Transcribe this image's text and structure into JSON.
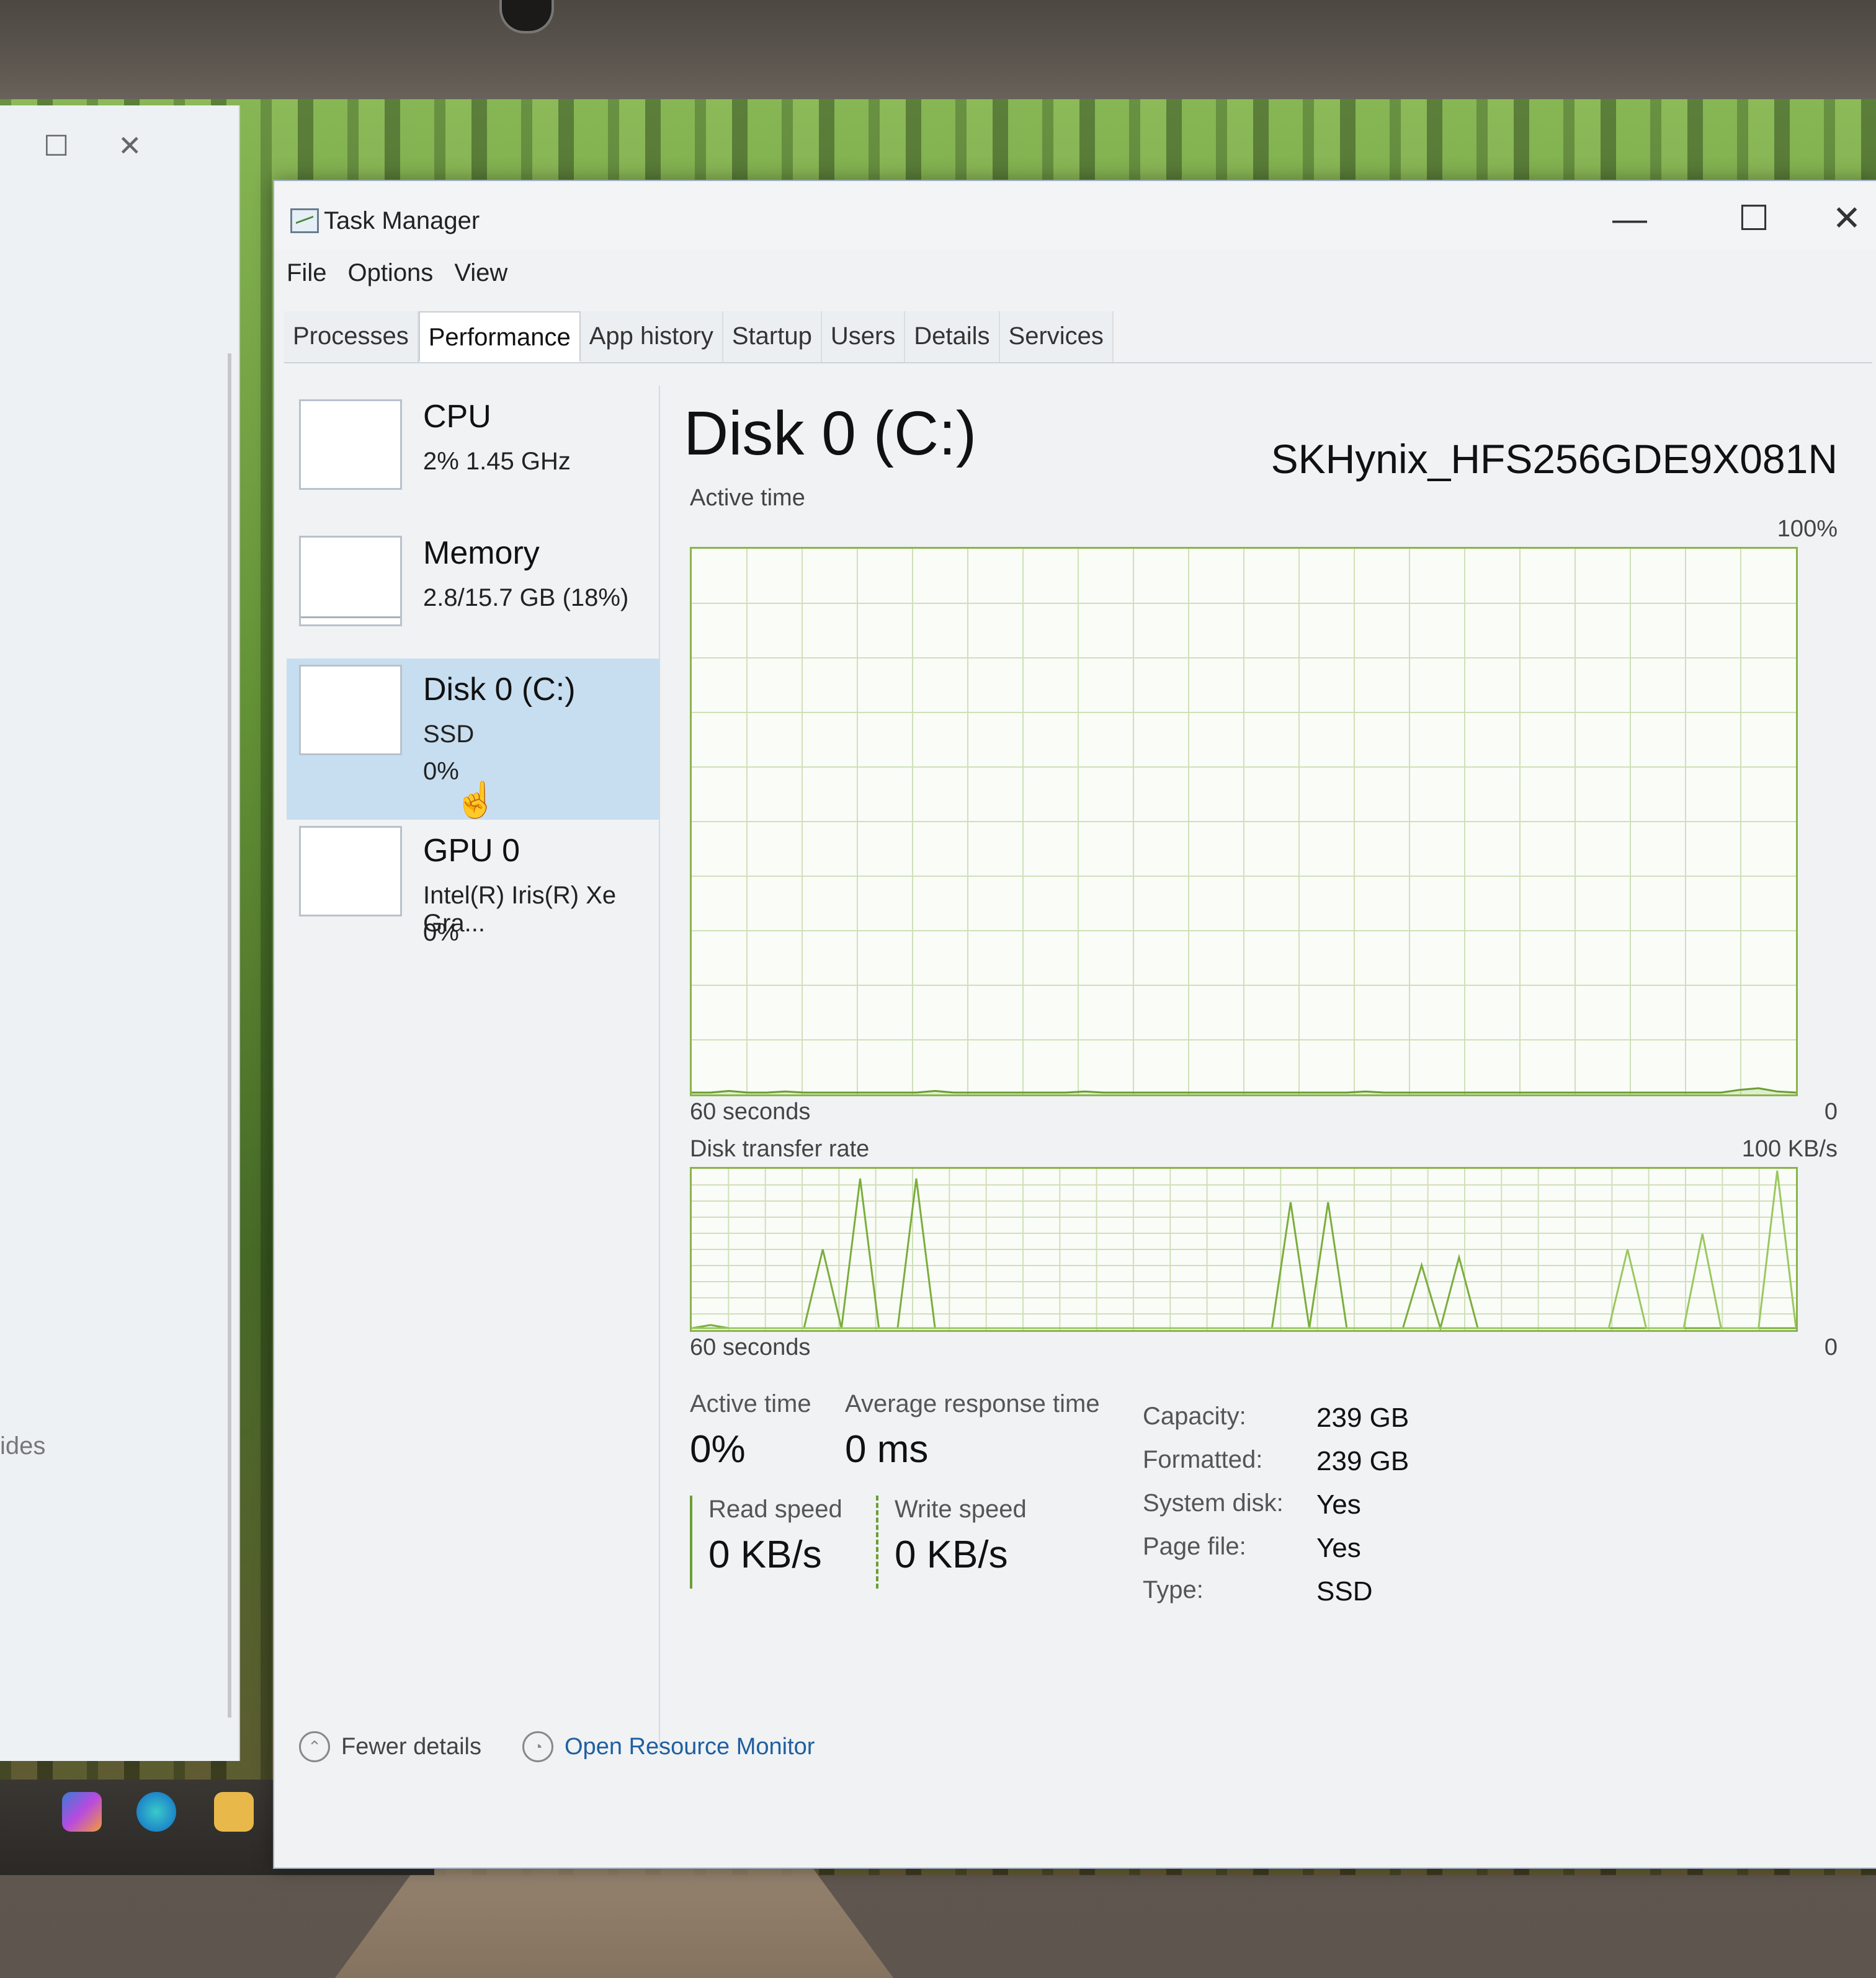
{
  "window": {
    "title": "Task Manager"
  },
  "menu": [
    "File",
    "Options",
    "View"
  ],
  "tabs": [
    "Processes",
    "Performance",
    "App history",
    "Startup",
    "Users",
    "Details",
    "Services"
  ],
  "active_tab": "Performance",
  "sidebar": {
    "items": [
      {
        "name": "CPU",
        "line1": "2% 1.45 GHz",
        "line2": ""
      },
      {
        "name": "Memory",
        "line1": "2.8/15.7 GB (18%)",
        "line2": ""
      },
      {
        "name": "Disk 0 (C:)",
        "line1": "SSD",
        "line2": "0%"
      },
      {
        "name": "GPU 0",
        "line1": "Intel(R) Iris(R) Xe Gra...",
        "line2": "0%"
      }
    ],
    "selected": "Disk 0 (C:)"
  },
  "main": {
    "title": "Disk 0 (C:)",
    "model": "SKHynix_HFS256GDE9X081N",
    "active_chart": {
      "label": "Active time",
      "max_label": "100%",
      "min_label": "0",
      "time_label": "60 seconds"
    },
    "transfer_chart": {
      "label": "Disk transfer rate",
      "max_label": "100 KB/s",
      "min_label": "0",
      "time_label": "60 seconds"
    },
    "stats": {
      "active_time_label": "Active time",
      "active_time_value": "0%",
      "avg_response_label": "Average response time",
      "avg_response_value": "0 ms",
      "read_label": "Read speed",
      "read_value": "0 KB/s",
      "write_label": "Write speed",
      "write_value": "0 KB/s"
    },
    "properties": [
      {
        "key": "Capacity:",
        "value": "239 GB"
      },
      {
        "key": "Formatted:",
        "value": "239 GB"
      },
      {
        "key": "System disk:",
        "value": "Yes"
      },
      {
        "key": "Page file:",
        "value": "Yes"
      },
      {
        "key": "Type:",
        "value": "SSD"
      }
    ]
  },
  "footer": {
    "fewer_details": "Fewer details",
    "open_resource_monitor": "Open Resource Monitor"
  },
  "background_window": {
    "peek_text": "ides"
  },
  "chart_data": [
    {
      "type": "area",
      "title": "Active time",
      "x_label": "60 seconds",
      "ylim": [
        0,
        100
      ],
      "values": [
        0,
        0,
        0.3,
        0,
        0,
        0.2,
        0,
        0,
        0,
        0,
        0,
        0,
        0,
        0.3,
        0,
        0,
        0,
        0,
        0,
        0,
        0,
        0.2,
        0,
        0,
        0,
        0,
        0,
        0,
        0,
        0,
        0,
        0,
        0,
        0,
        0,
        0,
        0.2,
        0,
        0,
        0,
        0,
        0,
        0,
        0,
        0,
        0,
        0,
        0,
        0,
        0,
        0,
        0,
        0,
        0,
        0,
        0,
        0.5,
        0.8,
        0.2,
        0
      ]
    },
    {
      "type": "line",
      "title": "Disk transfer rate",
      "x_label": "60 seconds",
      "ylim": [
        0,
        100
      ],
      "y_unit": "KB/s",
      "series": [
        {
          "values": [
            0,
            2,
            0,
            0,
            0,
            0,
            0,
            50,
            0,
            95,
            0,
            0,
            95,
            0,
            0,
            0,
            0,
            0,
            0,
            0,
            0,
            0,
            0,
            0,
            0,
            0,
            0,
            0,
            0,
            0,
            0,
            0,
            80,
            0,
            80,
            0,
            0,
            0,
            0,
            40,
            0,
            45,
            0,
            0,
            0,
            0,
            0,
            0,
            0,
            0,
            0,
            0,
            0,
            0,
            0,
            0,
            0,
            0,
            0,
            0
          ]
        },
        {
          "values": [
            0,
            0,
            0,
            0,
            0,
            0,
            0,
            0,
            0,
            0,
            0,
            0,
            0,
            0,
            0,
            0,
            0,
            0,
            0,
            0,
            0,
            0,
            0,
            0,
            0,
            0,
            0,
            0,
            0,
            0,
            0,
            0,
            0,
            0,
            0,
            0,
            0,
            0,
            0,
            0,
            0,
            0,
            0,
            0,
            0,
            0,
            0,
            0,
            0,
            0,
            50,
            0,
            0,
            0,
            60,
            0,
            0,
            0,
            100,
            0
          ]
        }
      ]
    }
  ]
}
